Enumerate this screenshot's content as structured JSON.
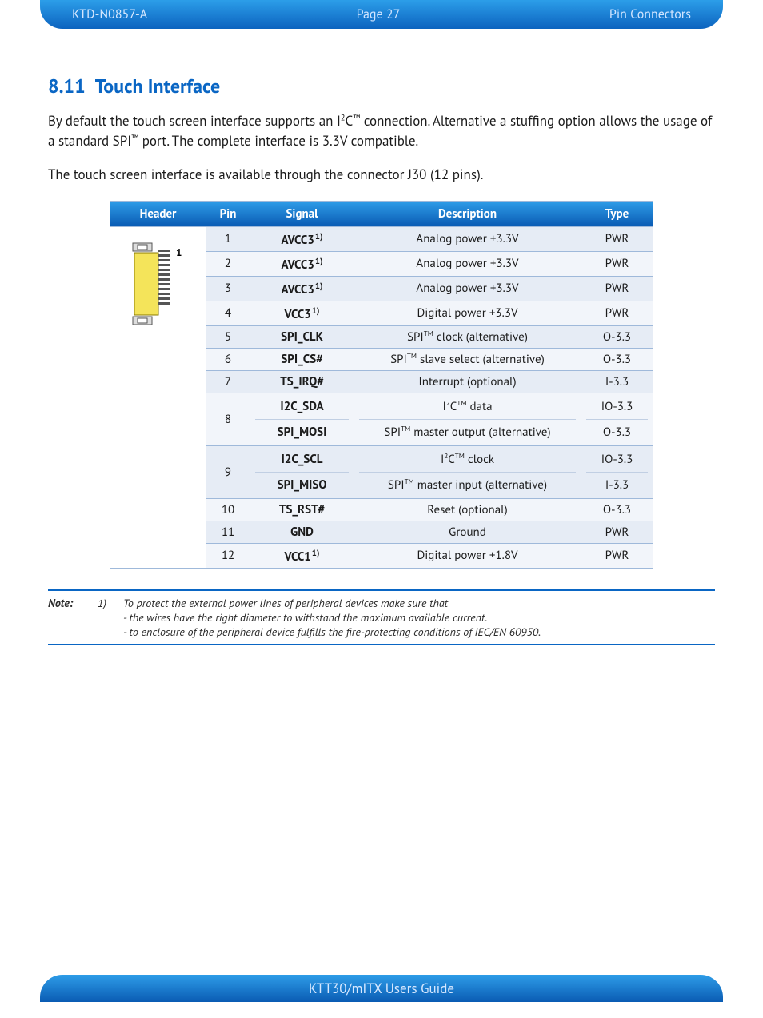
{
  "header": {
    "doc_id": "KTD-N0857-A",
    "page_label": "Page 27",
    "section": "Pin Connectors"
  },
  "heading": {
    "number": "8.11",
    "title": "Touch Interface"
  },
  "paragraphs": {
    "p1_a": "By default the touch screen interface supports an I",
    "p1_b": "C",
    "p1_c": " connection. Alternative a stuffing option allows the usage of a standard SPI",
    "p1_d": " port. The complete interface is 3.3V compatible.",
    "p2": "The touch screen interface is available through the connector J30 (12 pins)."
  },
  "table": {
    "cols": {
      "header": "Header",
      "pin": "Pin",
      "signal": "Signal",
      "description": "Description",
      "type": "Type"
    },
    "header_pin_label": "1",
    "rows": [
      {
        "pin": "1",
        "signal": "AVCC3",
        "fn": "1)",
        "desc": "Analog power +3.3V",
        "type": "PWR"
      },
      {
        "pin": "2",
        "signal": "AVCC3",
        "fn": "1)",
        "desc": "Analog power +3.3V",
        "type": "PWR"
      },
      {
        "pin": "3",
        "signal": "AVCC3",
        "fn": "1)",
        "desc": "Analog power +3.3V",
        "type": "PWR"
      },
      {
        "pin": "4",
        "signal": "VCC3",
        "fn": "1)",
        "desc": "Digital power +3.3V",
        "type": "PWR"
      },
      {
        "pin": "5",
        "signal": "SPI_CLK",
        "fn": "",
        "desc": "SPI™ clock (alternative)",
        "type": "O-3.3"
      },
      {
        "pin": "6",
        "signal": "SPI_CS#",
        "fn": "",
        "desc": "SPI™ slave select (alternative)",
        "type": "O-3.3"
      },
      {
        "pin": "7",
        "signal": "TS_IRQ#",
        "fn": "",
        "desc": "Interrupt (optional)",
        "type": "I-3.3"
      },
      {
        "pin": "8",
        "signal2": [
          "I2C_SDA",
          "SPI_MOSI"
        ],
        "desc2": [
          "I²C™ data",
          "SPI™ master output (alternative)"
        ],
        "type2": [
          "IO-3.3",
          "O-3.3"
        ]
      },
      {
        "pin": "9",
        "signal2": [
          "I2C_SCL",
          "SPI_MISO"
        ],
        "desc2": [
          "I²C™ clock",
          "SPI™ master input (alternative)"
        ],
        "type2": [
          "IO-3.3",
          "I-3.3"
        ]
      },
      {
        "pin": "10",
        "signal": "TS_RST#",
        "fn": "",
        "desc": "Reset (optional)",
        "type": "O-3.3"
      },
      {
        "pin": "11",
        "signal": "GND",
        "fn": "",
        "desc": "Ground",
        "type": "PWR"
      },
      {
        "pin": "12",
        "signal": "VCC1",
        "fn": "1)",
        "desc": "Digital power +1.8V",
        "type": "PWR"
      }
    ]
  },
  "note": {
    "label": "Note:",
    "num": "1)",
    "line1": "To protect the external power lines of peripheral devices make sure that",
    "line2": "- the wires have the right diameter to withstand the maximum available current.",
    "line3": "- to enclosure of the peripheral device fulfills the fire-protecting conditions of IEC/EN 60950."
  },
  "footer": {
    "title": "KTT30/mITX Users Guide"
  }
}
